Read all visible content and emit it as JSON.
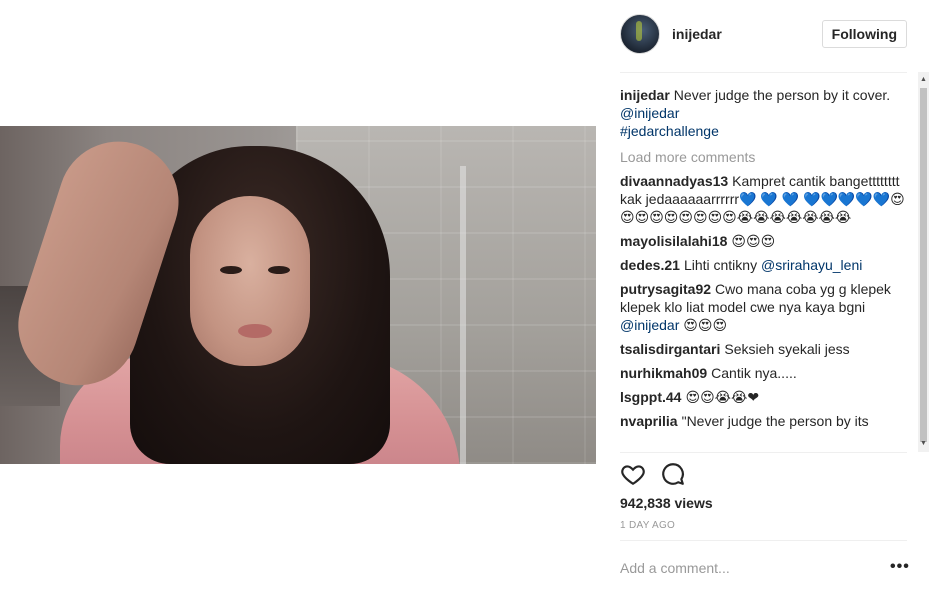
{
  "post": {
    "username": "inijedar",
    "follow_label": "Following",
    "caption_text": "Never judge the person by it cover.",
    "caption_mention": "@inijedar",
    "caption_hashtag": "#jedarchallenge",
    "load_more_label": "Load more comments"
  },
  "comments": [
    {
      "user": "divaannadyas13",
      "text": "Kampret cantik bangetttttttt kak jedaaaaaarrrrrr💙 💙 💙 💙💙💙💙💙😍😍😍😍😍😍😍😍😍😭😭😭😭😭😭😭"
    },
    {
      "user": "mayolisilalahi18",
      "text": "😍😍😍"
    },
    {
      "user": "dedes.21",
      "text": "Lihti cntikny",
      "mention": "@srirahayu_leni"
    },
    {
      "user": "putrysagita92",
      "text": "Cwo mana coba yg g klepek klepek klo liat model cwe nya kaya bgni",
      "mention": "@inijedar",
      "suffix": "😍😍😍"
    },
    {
      "user": "tsalisdirgantari",
      "text": "Seksieh syekali jess"
    },
    {
      "user": "nurhikmah09",
      "text": "Cantik nya....."
    },
    {
      "user": "lsgppt.44",
      "text": "😍😍😭😭❤"
    },
    {
      "user": "nvaprilia",
      "text": "\"Never judge the person by its"
    }
  ],
  "stats": {
    "views": "942,838 views",
    "time_ago": "1 DAY AGO"
  },
  "composer": {
    "placeholder": "Add a comment...",
    "more_label": "•••"
  },
  "icons": [
    "heart-icon",
    "comment-icon",
    "more-options-icon"
  ]
}
